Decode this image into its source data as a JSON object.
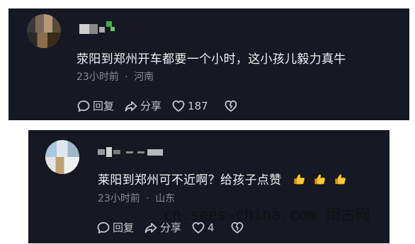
{
  "comments": [
    {
      "text": "荥阳到郑州开车都要一个小时，这小孩儿毅力真牛",
      "time": "23小时前",
      "separator": "·",
      "location": "河南",
      "reply_label": "回复",
      "share_label": "分享",
      "like_count": "187"
    },
    {
      "text": "莱阳到郑州可不近啊？给孩子点赞",
      "emojis": [
        "thumbs-up",
        "thumbs-up",
        "thumbs-up"
      ],
      "time": "23小时前",
      "separator": "·",
      "location": "山东",
      "reply_label": "回复",
      "share_label": "分享",
      "like_count": "4"
    }
  ],
  "watermark": {
    "url": "cn.sees-china.com",
    "brand": "闽古网"
  },
  "colors": {
    "card_background": "#161823",
    "text_primary": "#f1f1f2",
    "text_secondary": "#8a8b91",
    "emoji_yellow": "#ffcc33"
  }
}
